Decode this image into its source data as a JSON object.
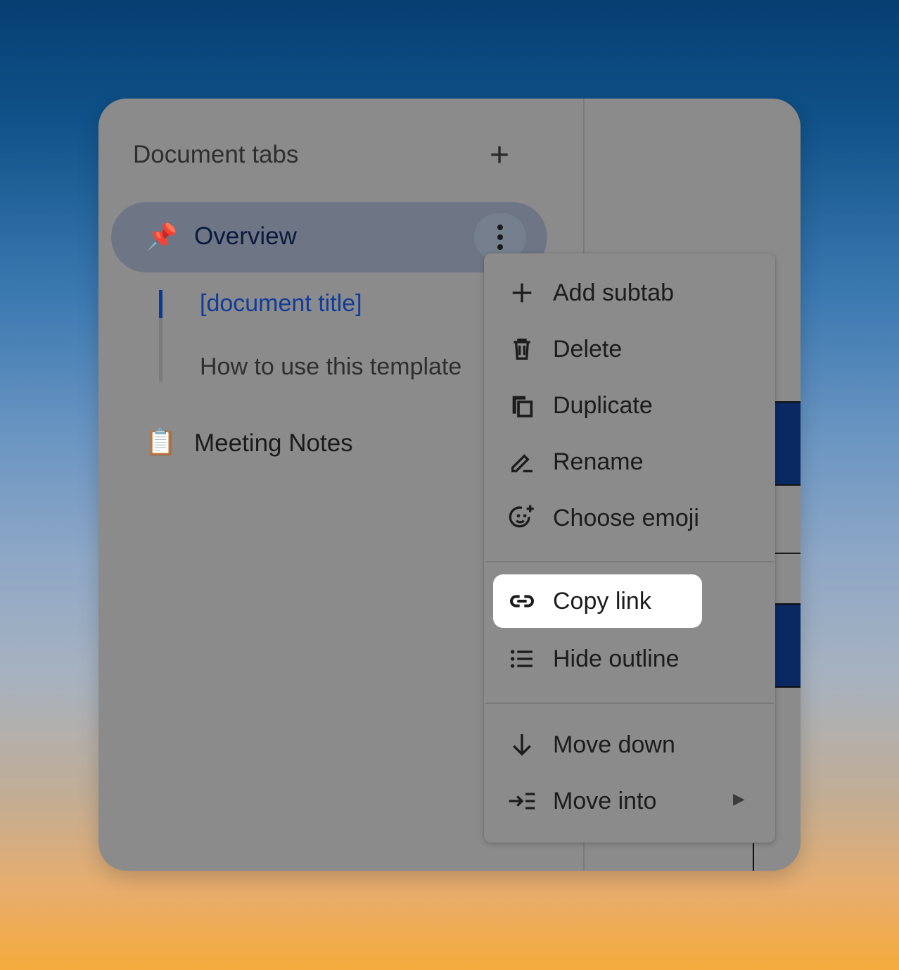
{
  "sidebar": {
    "title": "Document tabs",
    "add_tab_glyph": "+",
    "tabs": [
      {
        "emoji": "📌",
        "icon": "pushpin-emoji",
        "label": "Overview",
        "selected": true,
        "subtabs": [
          {
            "label": "[document title]",
            "active": true
          },
          {
            "label": "How to use this template",
            "active": false
          }
        ]
      },
      {
        "emoji": "📋",
        "icon": "clipboard-emoji",
        "label": "Meeting Notes",
        "selected": false
      }
    ]
  },
  "context_menu": {
    "items": [
      {
        "label": "Add subtab",
        "icon": "plus-icon"
      },
      {
        "label": "Delete",
        "icon": "trash-icon"
      },
      {
        "label": "Duplicate",
        "icon": "duplicate-icon"
      },
      {
        "label": "Rename",
        "icon": "rename-pen-icon"
      },
      {
        "label": "Choose emoji",
        "icon": "emoji-add-icon"
      },
      {
        "label": "Copy link",
        "icon": "link-icon",
        "highlighted": true
      },
      {
        "label": "Hide outline",
        "icon": "list-icon"
      },
      {
        "label": "Move down",
        "icon": "arrow-down-icon"
      },
      {
        "label": "Move into",
        "icon": "move-into-icon",
        "has_submenu": true
      }
    ],
    "submenu_glyph": "▶"
  },
  "colors": {
    "panel_overlay": "#8b8b8b",
    "selected_tab": "#6e7685",
    "active_subtab": "#113c9a",
    "highlight": "#ffffff",
    "doc_block": "#0a2862"
  }
}
